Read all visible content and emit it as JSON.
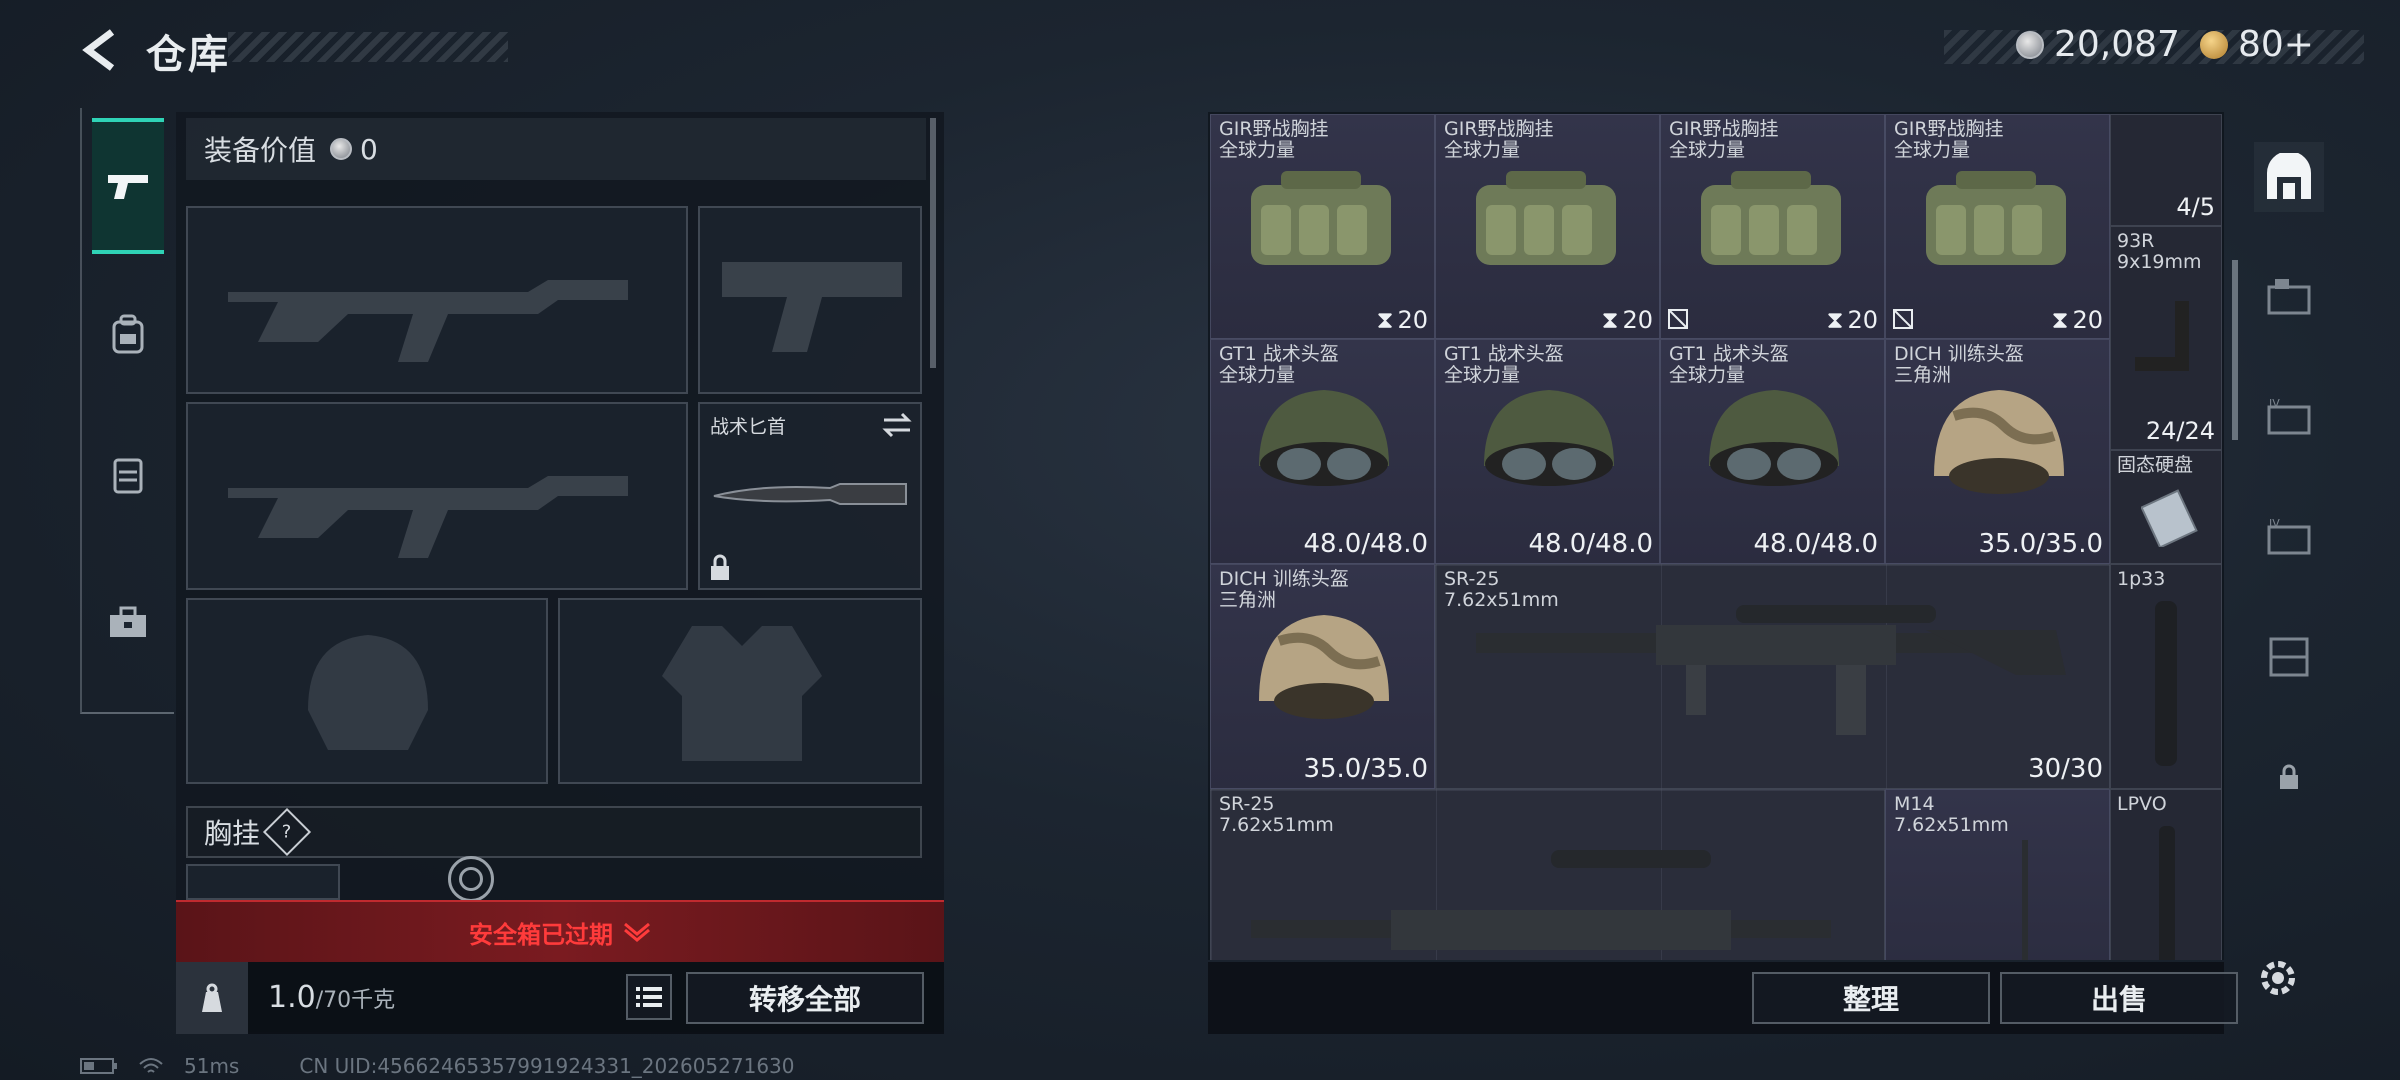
{
  "header": {
    "title": "仓库",
    "currency": {
      "coins": "20,087",
      "tri": "80+"
    }
  },
  "left": {
    "equip_value_label": "装备价值",
    "equip_value": "0",
    "knife_label": "战术匕首",
    "chest_label": "胸挂",
    "chest_help": "?",
    "expired": "安全箱已过期",
    "weight_current": "1.0",
    "weight_max": "/70千克",
    "transfer_all": "转移全部"
  },
  "grid": {
    "row1": [
      {
        "name": "GIR野战胸挂",
        "sub": "全球力量",
        "count": "20"
      },
      {
        "name": "GIR野战胸挂",
        "sub": "全球力量",
        "count": "20"
      },
      {
        "name": "GIR野战胸挂",
        "sub": "全球力量",
        "count": "20"
      },
      {
        "name": "GIR野战胸挂",
        "sub": "全球力量",
        "count": "20"
      }
    ],
    "row2": [
      {
        "name": "GT1 战术头盔",
        "sub": "全球力量",
        "val": "48.0/48.0"
      },
      {
        "name": "GT1 战术头盔",
        "sub": "全球力量",
        "val": "48.0/48.0"
      },
      {
        "name": "GT1 战术头盔",
        "sub": "全球力量",
        "val": "48.0/48.0"
      },
      {
        "name": "DICH 训练头盔",
        "sub": "三角洲",
        "val": "35.0/35.0"
      }
    ],
    "row3_helmet": {
      "name": "DICH 训练头盔",
      "sub": "三角洲",
      "val": "35.0/35.0"
    },
    "row3_rifle": {
      "name": "SR-25",
      "sub": "7.62x51mm",
      "val": "30/30"
    },
    "row4_rifle": {
      "name": "SR-25",
      "sub": "7.62x51mm"
    },
    "row4_m14": {
      "name": "M14",
      "sub": "7.62x51mm"
    },
    "side": {
      "c1_val": "4/5",
      "c2_name": "93R",
      "c2_sub": "9x19mm",
      "c2_val": "24/24",
      "c3_name": "固态硬盘",
      "c4_name": "1p33",
      "c5_name": "LPVO"
    }
  },
  "buttons": {
    "sort": "整理",
    "sell": "出售"
  },
  "status": {
    "ping": "51ms",
    "uid": "CN UID:4566246535799192433‌1_202605271630"
  }
}
